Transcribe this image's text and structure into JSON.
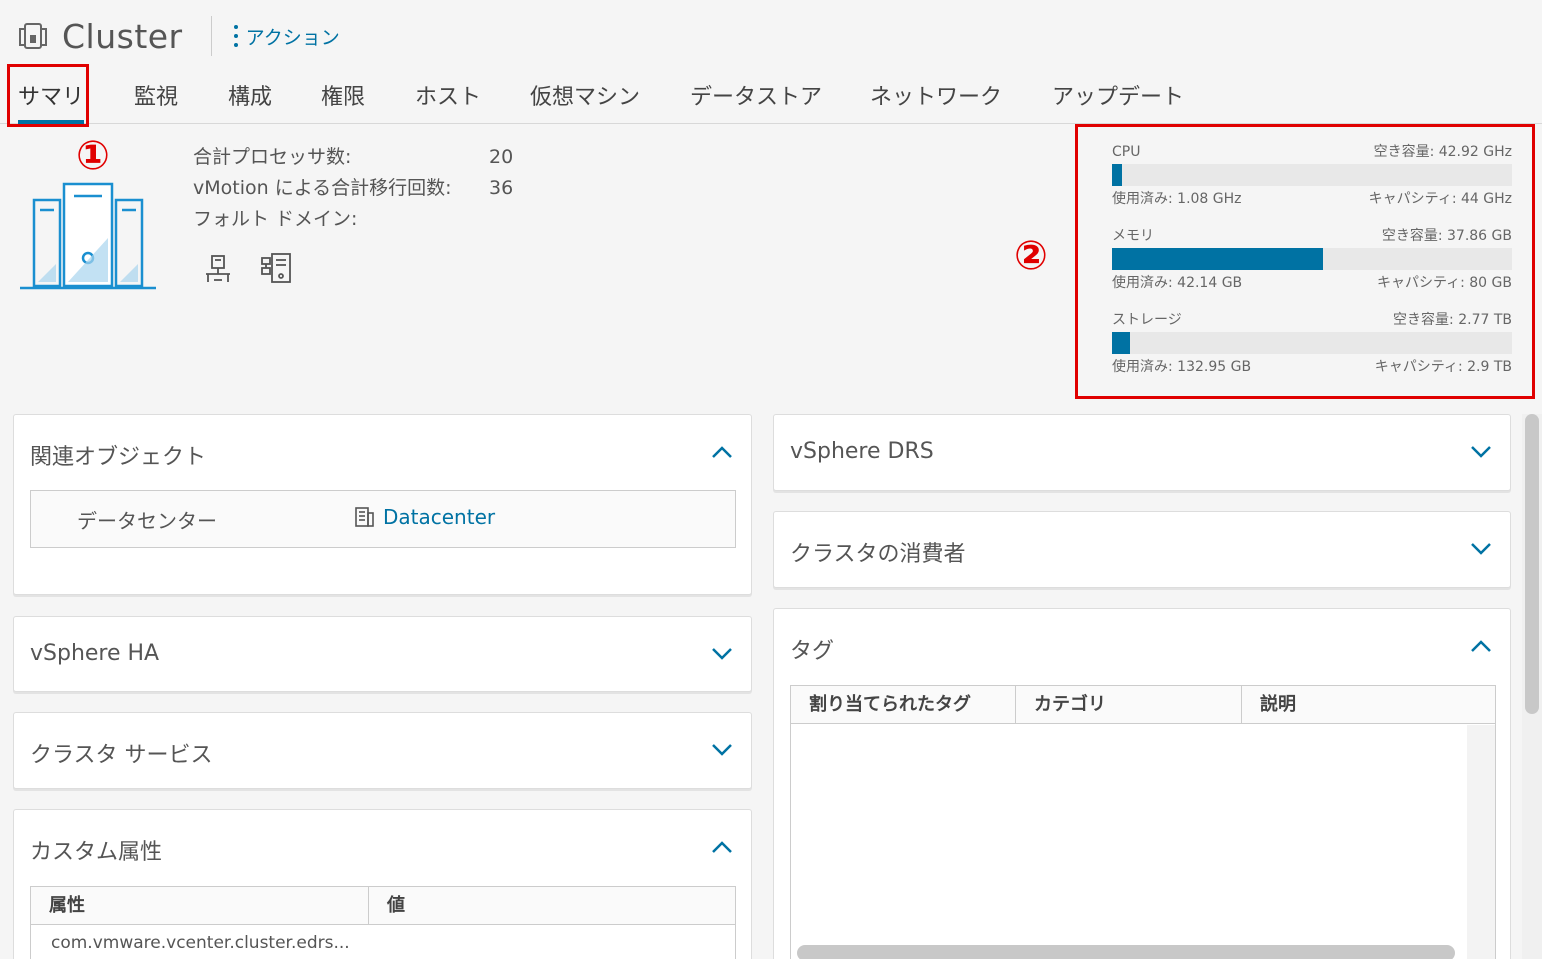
{
  "header": {
    "title": "Cluster",
    "actions_label": "アクション",
    "tabs": [
      {
        "label": "サマリ",
        "active": true
      },
      {
        "label": "監視"
      },
      {
        "label": "構成"
      },
      {
        "label": "権限"
      },
      {
        "label": "ホスト"
      },
      {
        "label": "仮想マシン"
      },
      {
        "label": "データストア"
      },
      {
        "label": "ネットワーク"
      },
      {
        "label": "アップデート"
      }
    ]
  },
  "annotations": {
    "marker1": "①",
    "marker2": "②",
    "color": "#e00000"
  },
  "summary": {
    "rows": [
      {
        "label": "合計プロセッサ数:",
        "value": "20"
      },
      {
        "label": "vMotion による合計移行回数:",
        "value": "36"
      },
      {
        "label": "フォルト ドメイン:",
        "value": ""
      }
    ],
    "icons": [
      "host-network-icon",
      "vm-list-icon"
    ]
  },
  "resources": [
    {
      "name": "CPU",
      "free": "空き容量: 42.92 GHz",
      "used": "使用済み: 1.08 GHz",
      "capacity": "キャパシティ: 44 GHz",
      "fraction": 0.025
    },
    {
      "name": "メモリ",
      "free": "空き容量: 37.86 GB",
      "used": "使用済み: 42.14 GB",
      "capacity": "キャパシティ: 80 GB",
      "fraction": 0.527
    },
    {
      "name": "ストレージ",
      "free": "空き容量: 2.77 TB",
      "used": "使用済み: 132.95 GB",
      "capacity": "キャパシティ: 2.9 TB",
      "fraction": 0.045
    }
  ],
  "cards": {
    "related": {
      "title": "関連オブジェクト",
      "label": "データセンター",
      "link": "Datacenter"
    },
    "ha": {
      "title": "vSphere HA"
    },
    "services": {
      "title": "クラスタ サービス"
    },
    "custom": {
      "title": "カスタム属性",
      "col_attr": "属性",
      "col_value": "値",
      "first_attr": "com.vmware.vcenter.cluster.edrs..."
    },
    "drs": {
      "title": "vSphere DRS"
    },
    "consumers": {
      "title": "クラスタの消費者"
    },
    "tags": {
      "title": "タグ",
      "col_tag": "割り当てられたタグ",
      "col_category": "カテゴリ",
      "col_desc": "説明"
    }
  },
  "colors": {
    "accent": "#0072a3",
    "background": "#f5f5f5"
  }
}
